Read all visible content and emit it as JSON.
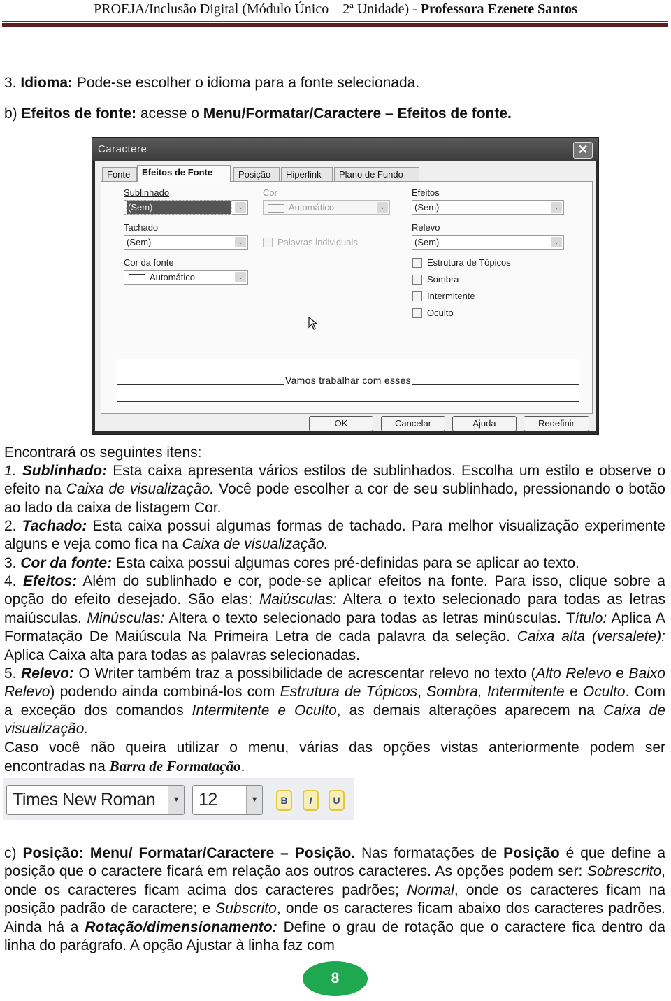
{
  "header": {
    "title_regular": "PROEJA/Inclusão Digital (Módulo Único – 2ª Unidade) - ",
    "title_bold": "Professora Ezenete Santos"
  },
  "intro": {
    "idioma_num": "3. ",
    "idioma_label": "Idioma:",
    "idioma_text": " Pode-se escolher o idioma para a fonte selecionada.",
    "b_prefix": "b) ",
    "b_label": "Efeitos de fonte:",
    "b_text": " acesse o ",
    "b_path": "Menu/Formatar/Caractere – Efeitos de fonte."
  },
  "dialog": {
    "title": "Caractere",
    "close_glyph": "✕",
    "tabs": [
      {
        "label": "Fonte",
        "active": false
      },
      {
        "label": "Efeitos de Fonte",
        "active": true
      },
      {
        "label": "Posição",
        "active": false
      },
      {
        "label": "Hiperlink",
        "active": false
      },
      {
        "label": "Plano de Fundo",
        "active": false
      }
    ],
    "sublinhado": {
      "label": "Sublinhado",
      "value": "(Sem)"
    },
    "cor": {
      "label": "Cor",
      "value": "Automático",
      "disabled": true
    },
    "tachado": {
      "label": "Tachado",
      "value": "(Sem)"
    },
    "palavras_individuais": {
      "label": "Palavras individuais",
      "checked": false,
      "disabled": true
    },
    "cor_da_fonte": {
      "label": "Cor da fonte",
      "value": "Automático"
    },
    "efeitos": {
      "label": "Efeitos",
      "value": "(Sem)"
    },
    "relevo": {
      "label": "Relevo",
      "value": "(Sem)"
    },
    "checkboxes": [
      {
        "label": "Estrutura de Tópicos",
        "checked": false
      },
      {
        "label": "Sombra",
        "checked": false
      },
      {
        "label": "Intermitente",
        "checked": false
      },
      {
        "label": "Oculto",
        "checked": false
      }
    ],
    "preview_text": "Vamos trabalhar com esses",
    "buttons": {
      "ok": "OK",
      "cancel": "Cancelar",
      "help": "Ajuda",
      "reset": "Redefinir"
    }
  },
  "body": {
    "encontrara": "Encontrará os seguintes itens:",
    "item1": {
      "num": "1. ",
      "label": "Sublinhado:",
      "t1": " Esta caixa apresenta vários estilos de sublinhados. Escolha um estilo e observe o efeito na ",
      "i1": "Caixa de visualização.",
      "t2": " Você pode escolher a cor de seu sublinhado, pressionando o botão ao lado da caixa de listagem Cor."
    },
    "item2": {
      "num": "2. ",
      "label": "Tachado:",
      "t1": " Esta caixa possui algumas formas de tachado. Para melhor visualização experimente alguns e veja como fica na ",
      "i1": "Caixa de visualização."
    },
    "item3": {
      "num": "3. ",
      "label": "Cor da fonte:",
      "t1": " Esta caixa possui algumas cores pré-definidas para se aplicar ao texto."
    },
    "item4": {
      "num": "4. ",
      "label": "Efeitos:",
      "t1": " Além do sublinhado e cor, pode-se aplicar efeitos na fonte. Para isso, clique sobre a opção do efeito desejado. São elas: ",
      "i1": "Maiúsculas:",
      "t2": " Altera o texto selecionado para todas as letras maiúsculas. ",
      "i2": "Minúsculas:",
      "t3": " Altera o texto selecionado para todas as letras minúsculas. T",
      "i3": "ítulo:",
      "t4": " Aplica A Formatação De Maiúscula Na Primeira Letra de cada palavra da seleção. ",
      "i4": "Caixa alta (versalete):",
      "t5": " Aplica Caixa alta para todas as palavras selecionadas."
    },
    "item5": {
      "num": "5. ",
      "label": "Relevo:",
      "t1": " O Writer também traz a possibilidade de acrescentar relevo no texto (",
      "i1": "Alto Relevo",
      "t2": " e ",
      "i2": "Baixo Relevo",
      "t3": ") podendo ainda combiná-los com ",
      "i3": "Estrutura de Tópicos",
      "t4": ", ",
      "i4": "Sombra, Intermitente",
      "t5": " e ",
      "i5": "Oculto",
      "t6": ". Com a exceção dos comandos ",
      "i6": "Intermitente e Oculto",
      "t7": ", as demais alterações aparecem na ",
      "i7": "Caixa de visualização."
    },
    "caso": {
      "t1": "Caso você não queira utilizar o menu, várias das opções vistas anteriormente podem ser encontradas na ",
      "b1": "Barra de Formatação",
      "t2": "."
    }
  },
  "formatting_bar": {
    "font_name": "Times New Roman",
    "font_size": "12",
    "bold_glyph": "B",
    "italic_glyph": "I",
    "underline_glyph": "U"
  },
  "section_c": {
    "prefix": "c) ",
    "label": "Posição: Menu/ Formatar/Caractere – Posição.",
    "t1": " Nas formatações de ",
    "b1": "Posição",
    "t2": " é que define a posição que o caractere ficará em relação aos outros caracteres. As opções podem ser: ",
    "i1": "Sobrescrito",
    "t3": ", onde os caracteres ficam acima dos caracteres padrões; ",
    "i2": "Normal",
    "t4": ", onde os caracteres ficam na posição padrão de caractere; e ",
    "i3": "Subscrito",
    "t5": ", onde os caracteres ficam abaixo dos caracteres padrões.  Ainda há a ",
    "bi1": "Rotação/dimensionamento:",
    "t6": " Define o grau de rotação que o caractere fica dentro da linha do parágrafo. A opção Ajustar à linha faz com"
  },
  "page_number": "8",
  "colors": {
    "header_rule": "#5e1f1f",
    "page_badge": "#1ea84f"
  }
}
